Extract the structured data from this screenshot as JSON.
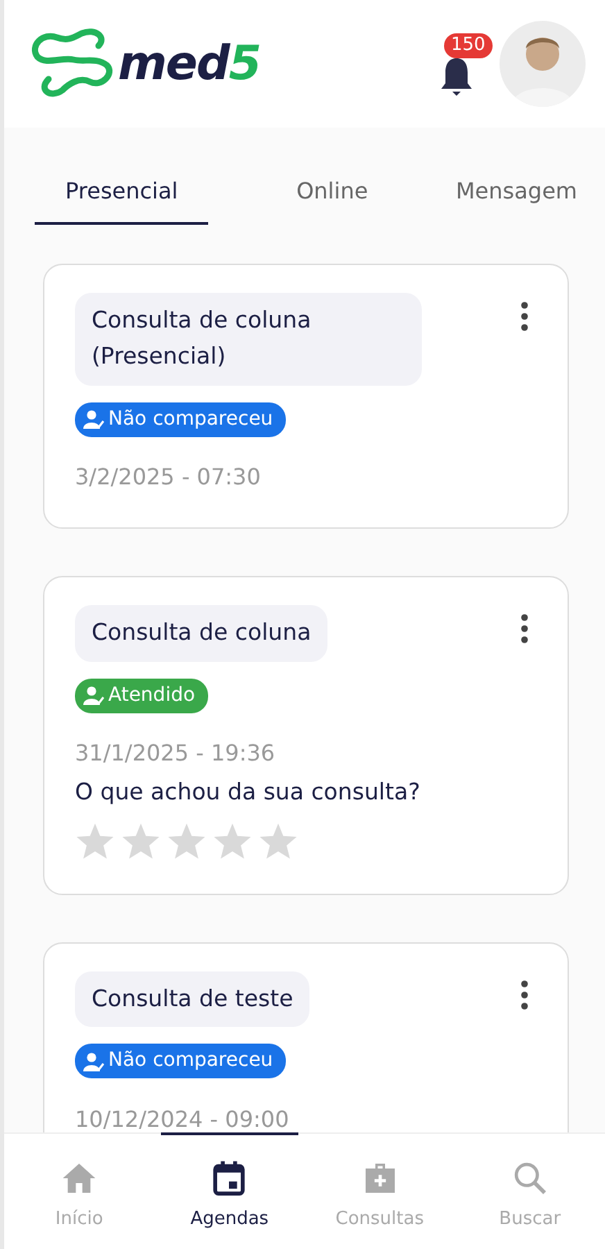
{
  "header": {
    "logo_text": "med",
    "logo_accent": "5",
    "notification_count": "150"
  },
  "tabs": [
    {
      "label": "Presencial",
      "selected": true
    },
    {
      "label": "Online",
      "selected": false
    },
    {
      "label": "Mensagem",
      "selected": false
    }
  ],
  "appointments": [
    {
      "title": "Consulta de coluna (Presencial)",
      "status": {
        "label": "Não compareceu",
        "color": "#1a73e8"
      },
      "datetime": "3/2/2025 - 07:30"
    },
    {
      "title": "Consulta de coluna",
      "status": {
        "label": "Atendido",
        "color": "#3aa84a"
      },
      "datetime": "31/1/2025 - 19:36",
      "rating": {
        "question": "O que achou da sua consulta?",
        "stars": 0
      }
    },
    {
      "title": "Consulta de teste",
      "status": {
        "label": "Não compareceu",
        "color": "#1a73e8"
      },
      "datetime": "10/12/2024 - 09:00"
    }
  ],
  "bottom_nav": [
    {
      "label": "Início",
      "kind": "home",
      "selected": false
    },
    {
      "label": "Agendas",
      "kind": "calendar",
      "selected": true
    },
    {
      "label": "Consultas",
      "kind": "medkit",
      "selected": false
    },
    {
      "label": "Buscar",
      "kind": "search",
      "selected": false
    }
  ]
}
